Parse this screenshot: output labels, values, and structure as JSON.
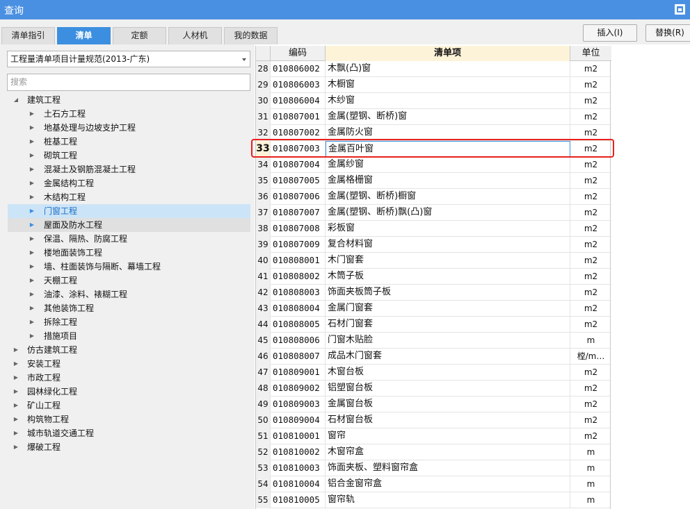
{
  "window": {
    "title": "查询"
  },
  "tabs": [
    {
      "label": "清单指引",
      "active": false
    },
    {
      "label": "清单",
      "active": true
    },
    {
      "label": "定额",
      "active": false
    },
    {
      "label": "人材机",
      "active": false
    },
    {
      "label": "我的数据",
      "active": false
    }
  ],
  "actions": {
    "insert_label": "插入(I)",
    "replace_label": "替换(R)"
  },
  "left": {
    "standard_select": "工程量清单项目计量规范(2013-广东)",
    "search_placeholder": "搜索",
    "tree": [
      {
        "label": "建筑工程",
        "level": 0,
        "expanded": true
      },
      {
        "label": "土石方工程",
        "level": 1
      },
      {
        "label": "地基处理与边坡支护工程",
        "level": 1
      },
      {
        "label": "桩基工程",
        "level": 1
      },
      {
        "label": "砌筑工程",
        "level": 1
      },
      {
        "label": "混凝土及钢筋混凝土工程",
        "level": 1
      },
      {
        "label": "金属结构工程",
        "level": 1
      },
      {
        "label": "木结构工程",
        "level": 1
      },
      {
        "label": "门窗工程",
        "level": 1,
        "state": "selected"
      },
      {
        "label": "屋面及防水工程",
        "level": 1,
        "state": "hover"
      },
      {
        "label": "保温、隔热、防腐工程",
        "level": 1
      },
      {
        "label": "楼地面装饰工程",
        "level": 1
      },
      {
        "label": "墙、柱面装饰与隔断、幕墙工程",
        "level": 1
      },
      {
        "label": "天棚工程",
        "level": 1
      },
      {
        "label": "油漆、涂料、裱糊工程",
        "level": 1
      },
      {
        "label": "其他装饰工程",
        "level": 1
      },
      {
        "label": "拆除工程",
        "level": 1
      },
      {
        "label": "措施项目",
        "level": 1
      },
      {
        "label": "仿古建筑工程",
        "level": 0
      },
      {
        "label": "安装工程",
        "level": 0
      },
      {
        "label": "市政工程",
        "level": 0
      },
      {
        "label": "园林绿化工程",
        "level": 0
      },
      {
        "label": "矿山工程",
        "level": 0
      },
      {
        "label": "构筑物工程",
        "level": 0
      },
      {
        "label": "城市轨道交通工程",
        "level": 0
      },
      {
        "label": "爆破工程",
        "level": 0
      }
    ]
  },
  "grid": {
    "headers": {
      "num": "",
      "code": "编码",
      "item": "清单项",
      "unit": "单位"
    },
    "current_row": "33",
    "rows": [
      {
        "num": "28",
        "code": "010806002",
        "item": "木飘(凸)窗",
        "unit": "m2"
      },
      {
        "num": "29",
        "code": "010806003",
        "item": "木橱窗",
        "unit": "m2"
      },
      {
        "num": "30",
        "code": "010806004",
        "item": "木纱窗",
        "unit": "m2"
      },
      {
        "num": "31",
        "code": "010807001",
        "item": "金属(塑钢、断桥)窗",
        "unit": "m2"
      },
      {
        "num": "32",
        "code": "010807002",
        "item": "金属防火窗",
        "unit": "m2"
      },
      {
        "num": "33",
        "code": "010807003",
        "item": "金属百叶窗",
        "unit": "m2"
      },
      {
        "num": "34",
        "code": "010807004",
        "item": "金属纱窗",
        "unit": "m2"
      },
      {
        "num": "35",
        "code": "010807005",
        "item": "金属格栅窗",
        "unit": "m2"
      },
      {
        "num": "36",
        "code": "010807006",
        "item": "金属(塑钢、断桥)橱窗",
        "unit": "m2"
      },
      {
        "num": "37",
        "code": "010807007",
        "item": "金属(塑钢、断桥)飘(凸)窗",
        "unit": "m2"
      },
      {
        "num": "38",
        "code": "010807008",
        "item": "彩板窗",
        "unit": "m2"
      },
      {
        "num": "39",
        "code": "010807009",
        "item": "复合材料窗",
        "unit": "m2"
      },
      {
        "num": "40",
        "code": "010808001",
        "item": "木门窗套",
        "unit": "m2"
      },
      {
        "num": "41",
        "code": "010808002",
        "item": "木筒子板",
        "unit": "m2"
      },
      {
        "num": "42",
        "code": "010808003",
        "item": "饰面夹板筒子板",
        "unit": "m2"
      },
      {
        "num": "43",
        "code": "010808004",
        "item": "金属门窗套",
        "unit": "m2"
      },
      {
        "num": "44",
        "code": "010808005",
        "item": "石材门窗套",
        "unit": "m2"
      },
      {
        "num": "45",
        "code": "010808006",
        "item": "门窗木贴脸",
        "unit": "m"
      },
      {
        "num": "46",
        "code": "010808007",
        "item": "成品木门窗套",
        "unit": "樘/m…"
      },
      {
        "num": "47",
        "code": "010809001",
        "item": "木窗台板",
        "unit": "m2"
      },
      {
        "num": "48",
        "code": "010809002",
        "item": "铝塑窗台板",
        "unit": "m2"
      },
      {
        "num": "49",
        "code": "010809003",
        "item": "金属窗台板",
        "unit": "m2"
      },
      {
        "num": "50",
        "code": "010809004",
        "item": "石材窗台板",
        "unit": "m2"
      },
      {
        "num": "51",
        "code": "010810001",
        "item": "窗帘",
        "unit": "m2"
      },
      {
        "num": "52",
        "code": "010810002",
        "item": "木窗帘盒",
        "unit": "m"
      },
      {
        "num": "53",
        "code": "010810003",
        "item": "饰面夹板、塑料窗帘盒",
        "unit": "m"
      },
      {
        "num": "54",
        "code": "010810004",
        "item": "铝合金窗帘盒",
        "unit": "m"
      },
      {
        "num": "55",
        "code": "010810005",
        "item": "窗帘轨",
        "unit": "m"
      }
    ]
  },
  "colors": {
    "accent": "#3c8fe0",
    "titlebar": "#4a90e2",
    "highlight_box": "#e8201c",
    "selected_row": "#fdf3d8"
  }
}
